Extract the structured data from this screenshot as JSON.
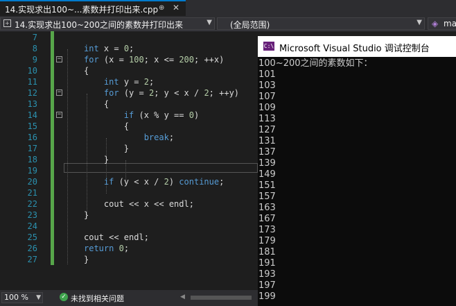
{
  "tab": {
    "title": "14.实现求出100~...素数并打印出来.cpp",
    "pin": "⊕",
    "close": "✕"
  },
  "navbar": {
    "file_combo": "14.实现求出100~200之间的素数并打印出来",
    "scope_combo": "(全局范围)",
    "member_combo": "ma"
  },
  "editor": {
    "lines": [
      {
        "n": "7",
        "html": ""
      },
      {
        "n": "8",
        "html": "<span class='kw'>int</span> x = <span class='num'>0</span>;"
      },
      {
        "n": "9",
        "html": "<span class='kw'>for</span> (x = <span class='num'>100</span>; x &lt;= <span class='num'>200</span>; ++x)"
      },
      {
        "n": "10",
        "html": "{"
      },
      {
        "n": "11",
        "html": "    <span class='kw'>int</span> y = <span class='num'>2</span>;"
      },
      {
        "n": "12",
        "html": "    <span class='kw'>for</span> (y = <span class='num'>2</span>; y &lt; x / <span class='num'>2</span>; ++y)"
      },
      {
        "n": "13",
        "html": "    {"
      },
      {
        "n": "14",
        "html": "        <span class='kw'>if</span> (x % y == <span class='num'>0</span>)"
      },
      {
        "n": "15",
        "html": "        {"
      },
      {
        "n": "16",
        "html": "            <span class='kw'>break</span>;"
      },
      {
        "n": "17",
        "html": "        }"
      },
      {
        "n": "18",
        "html": "    }"
      },
      {
        "n": "19",
        "html": ""
      },
      {
        "n": "20",
        "html": "    <span class='kw'>if</span> (y &lt; x / <span class='num'>2</span>) <span class='kw'>continue</span>;"
      },
      {
        "n": "21",
        "html": ""
      },
      {
        "n": "22",
        "html": "    cout &lt;&lt; x &lt;&lt; endl;"
      },
      {
        "n": "23",
        "html": "}"
      },
      {
        "n": "24",
        "html": ""
      },
      {
        "n": "25",
        "html": "cout &lt;&lt; endl;"
      },
      {
        "n": "26",
        "html": "<span class='kw'>return</span> <span class='num'>0</span>;"
      },
      {
        "n": "27",
        "html": "}"
      }
    ],
    "fold_lines": [
      "9",
      "12",
      "14"
    ]
  },
  "statusbar": {
    "zoom": "100 %",
    "status": "未找到相关问题"
  },
  "console": {
    "title": "Microsoft Visual Studio 调试控制台",
    "icon_text": "C:\\",
    "header": "100~200之间的素数如下：",
    "primes": [
      "101",
      "103",
      "107",
      "109",
      "113",
      "127",
      "131",
      "137",
      "139",
      "149",
      "151",
      "157",
      "163",
      "167",
      "173",
      "179",
      "181",
      "191",
      "193",
      "197",
      "199"
    ]
  },
  "colors": {
    "accent": "#007acc",
    "change_bar": "#57a64a",
    "keyword": "#569cd6",
    "number": "#b5cea8",
    "line_number": "#2b91af"
  }
}
